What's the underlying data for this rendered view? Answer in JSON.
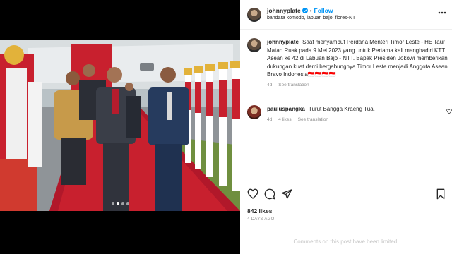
{
  "post": {
    "username": "johnnyplate",
    "follow_label": "Follow",
    "separator": "•",
    "location": "bandara komodo, labuan bajo, flores-NTT",
    "more_icon": "more-icon"
  },
  "caption": {
    "username": "johnnyplate",
    "text": "Saat menyambut Perdana Menteri Timor Leste - HE Taur Matan Ruak pada 9 Mei 2023 yang untuk Pertama kali menghadiri KTT Asean ke 42 di Labuan Bajo - NTT. Bapak Presiden Jokowi memberikan dukungan kuat demi bergabungnya Timor Leste menjadi Anggota Asean. Bravo Indonesia🇮🇩🇮🇩🇮🇩🇮🇩",
    "age": "4d",
    "translate": "See translation"
  },
  "comment": {
    "username": "pauluspangka",
    "text": "Turut Bangga Kraeng Tua.",
    "age": "4d",
    "likes": "4 likes",
    "translate": "See translation"
  },
  "stats": {
    "likes": "842 likes",
    "posted": "4 DAYS AGO"
  },
  "footer": {
    "notice": "Comments on this post have been limited."
  },
  "carousel": {
    "total": 4,
    "active": 1
  },
  "colors": {
    "link_blue": "#0095f6",
    "carpet_red": "#c8202e",
    "text_dark": "#262626",
    "muted": "#8e8e8e"
  }
}
